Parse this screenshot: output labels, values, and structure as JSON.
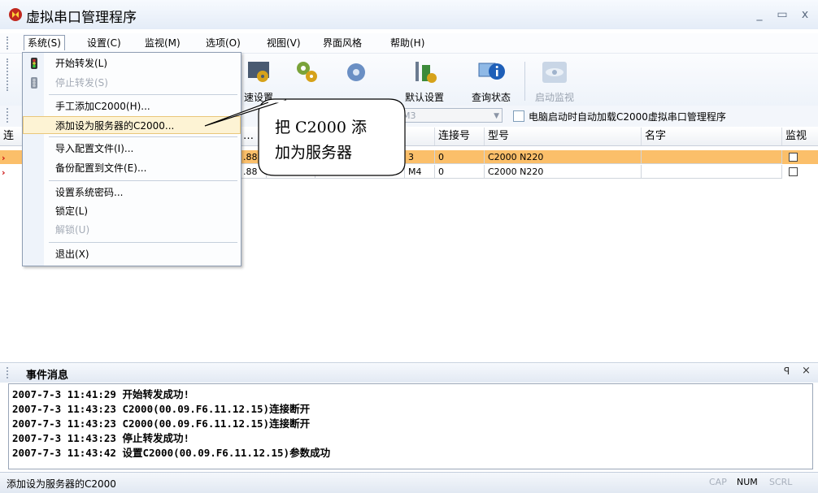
{
  "window": {
    "title": "虚拟串口管理程序",
    "controls": [
      "_",
      "▭",
      "x"
    ]
  },
  "menubar": {
    "items": [
      "系统(S)",
      "设置(C)",
      "监视(M)",
      "选项(O)",
      "视图(V)",
      "界面风格",
      "帮助(H)"
    ]
  },
  "toolbar": {
    "tools": [
      {
        "label": "速设置",
        "enabled": true
      },
      {
        "label": "",
        "enabled": true
      },
      {
        "label": "",
        "enabled": true
      },
      {
        "label": "默认设置",
        "enabled": true
      },
      {
        "label": "查询状态",
        "enabled": true
      },
      {
        "label": "启动监视",
        "enabled": false
      }
    ]
  },
  "combobar": {
    "combo_value": "M3",
    "autoload_label": "电脑启动时自动加载C2000虚拟串口管理程序",
    "autoload_checked": false
  },
  "table": {
    "columns": [
      "…",
      "连接号",
      "型号",
      "名字",
      "监视"
    ],
    "rows": [
      {
        "ip_frag": ".88",
        "port_frag": "3",
        "conn": "0",
        "model": "C2000 N220",
        "name": "",
        "selected": true
      },
      {
        "ip_frag": ".88",
        "port_frag": "M4",
        "conn": "0",
        "model": "C2000 N220",
        "name": "",
        "selected": false
      }
    ]
  },
  "system_menu": {
    "items": [
      {
        "label": "开始转发(L)",
        "enabled": true,
        "icon": "traffic-light-green-icon"
      },
      {
        "label": "停止转发(S)",
        "enabled": false,
        "icon": "traffic-light-gray-icon"
      },
      {
        "label": "手工添加C2000(H)...",
        "enabled": true
      },
      {
        "label": "添加设为服务器的C2000...",
        "enabled": true,
        "highlighted": true
      },
      {
        "label": "导入配置文件(I)...",
        "enabled": true
      },
      {
        "label": "备份配置到文件(E)...",
        "enabled": true
      },
      {
        "label": "设置系统密码...",
        "enabled": true
      },
      {
        "label": "锁定(L)",
        "enabled": true
      },
      {
        "label": "解锁(U)",
        "enabled": false
      },
      {
        "label": "退出(X)",
        "enabled": true
      }
    ]
  },
  "callout": {
    "line1": "把 C2000 添",
    "line2": "加为服务器"
  },
  "events": {
    "title": "事件消息",
    "pin": "ꟼ",
    "close": "×",
    "lines": [
      "2007-7-3 11:41:29 开始转发成功!",
      "2007-7-3 11:43:23 C2000(00.09.F6.11.12.15)连接断开",
      "2007-7-3 11:43:23 C2000(00.09.F6.11.12.15)连接断开",
      "2007-7-3 11:43:23 停止转发成功!",
      "2007-7-3 11:43:42 设置C2000(00.09.F6.11.12.15)参数成功"
    ]
  },
  "statusbar": {
    "text": "添加设为服务器的C2000",
    "cap": "CAP",
    "num": "NUM",
    "scrl": "SCRL"
  },
  "colors": {
    "selected_row": "#fbbf6a",
    "menu_highlight": "#fdf3d4",
    "accent_red": "#cc1010"
  }
}
